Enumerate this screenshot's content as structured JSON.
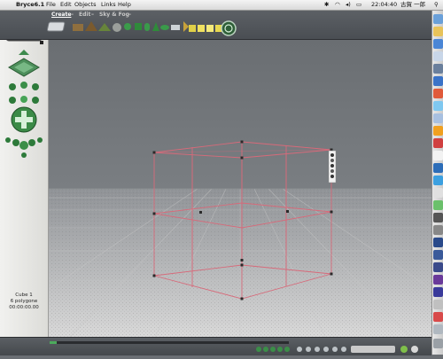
{
  "menubar": {
    "app_name": "Bryce6.1",
    "items": [
      "File",
      "Edit",
      "Objects",
      "Links",
      "Help"
    ],
    "clock": "22:04:40",
    "user": "古賀 一郎"
  },
  "toolbar": {
    "tabs": [
      {
        "label": "Create"
      },
      {
        "label": "Edit"
      },
      {
        "label": "Sky & Fog"
      }
    ],
    "separator": "–"
  },
  "status": {
    "object_name": "Cube 1",
    "polygons": "6 polygone",
    "timecode": "00:00:00.00"
  },
  "colors": {
    "wireframe": "#d76a7a",
    "accent_green": "#2f8a3a",
    "grid": "#b7b7b7",
    "sky": "#6c7075"
  },
  "icons": [
    "apple-icon",
    "bluetooth-icon",
    "wifi-icon",
    "volume-icon",
    "battery-icon",
    "spotlight-icon"
  ]
}
